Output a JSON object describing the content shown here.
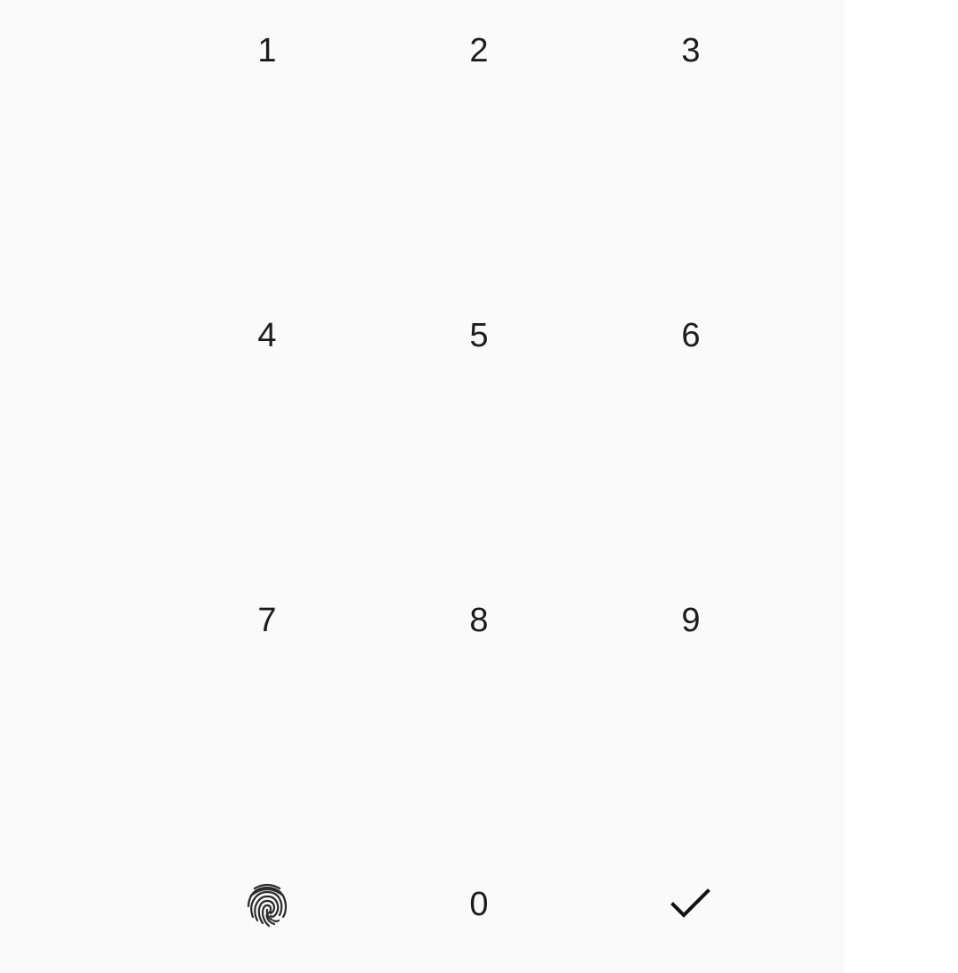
{
  "keypad": {
    "keys": {
      "k1": "1",
      "k2": "2",
      "k3": "3",
      "k4": "4",
      "k5": "5",
      "k6": "6",
      "k7": "7",
      "k8": "8",
      "k9": "9",
      "k0": "0"
    },
    "icons": {
      "biometric": "fingerprint-icon",
      "confirm": "checkmark-icon"
    }
  }
}
